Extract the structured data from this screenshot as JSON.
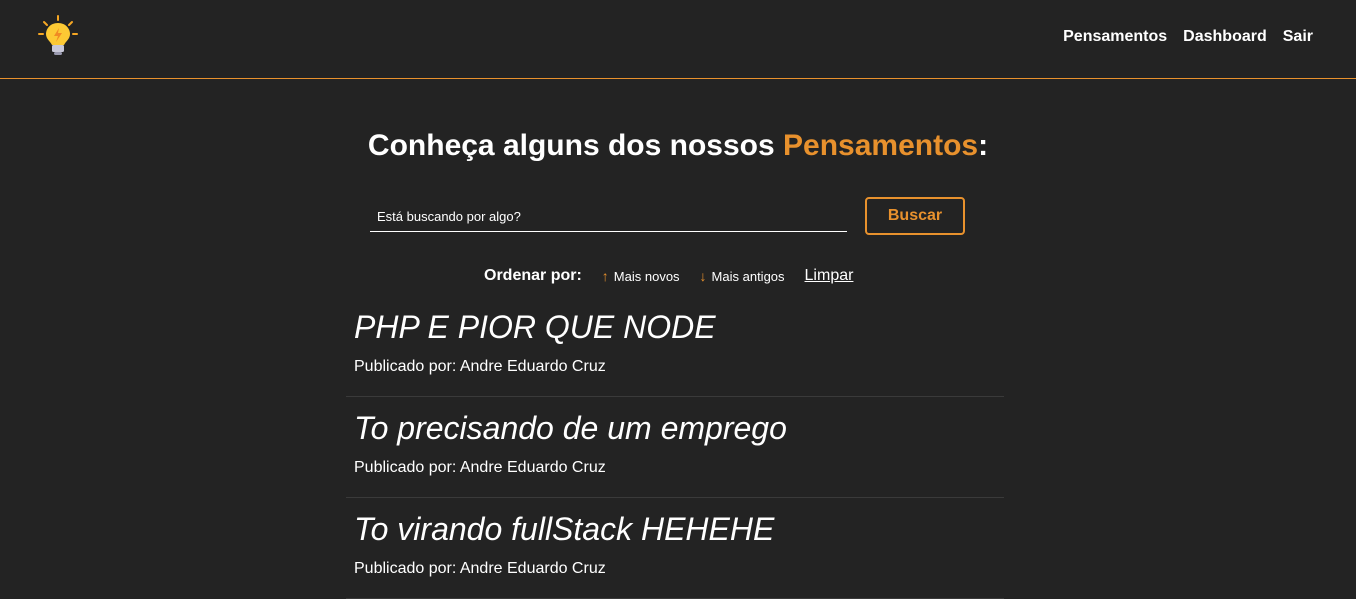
{
  "nav": {
    "logo_icon": "lightbulb-icon",
    "links": [
      "Pensamentos",
      "Dashboard",
      "Sair"
    ]
  },
  "heading": {
    "prefix": "Conheça alguns dos nossos ",
    "accent": "Pensamentos",
    "suffix": ":"
  },
  "search": {
    "placeholder": "Está buscando por algo?",
    "value": "",
    "button_label": "Buscar"
  },
  "order": {
    "label": "Ordenar por:",
    "newest_arrow": "↑",
    "newest_label": "Mais novos",
    "oldest_arrow": "↓",
    "oldest_label": "Mais antigos",
    "clear_label": "Limpar"
  },
  "thoughts": [
    {
      "title": "PHP E PIOR QUE NODE",
      "author": "Publicado por: Andre Eduardo Cruz"
    },
    {
      "title": "To precisando de um emprego",
      "author": "Publicado por: Andre Eduardo Cruz"
    },
    {
      "title": "To virando fullStack HEHEHE",
      "author": "Publicado por: Andre Eduardo Cruz"
    }
  ],
  "colors": {
    "background": "#232323",
    "accent": "#e8912d",
    "text": "#ffffff"
  }
}
